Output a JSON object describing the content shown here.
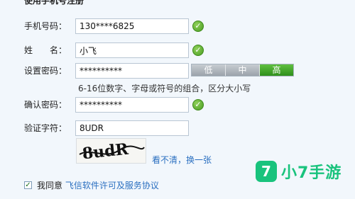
{
  "form": {
    "section_title": "使用手机号注册",
    "phone": {
      "label": "手机号码：",
      "value": "130****6825",
      "valid": true
    },
    "name": {
      "label": "姓　　名：",
      "value": "小飞",
      "valid": true
    },
    "password": {
      "label": "设置密码：",
      "value": "**********",
      "strength": {
        "options": [
          "低",
          "中",
          "高"
        ],
        "selected": "高"
      },
      "hint": "6-16位数字、字母或符号的组合，区分大小写"
    },
    "confirm": {
      "label": "确认密码：",
      "value": "**********",
      "valid": true
    },
    "captcha": {
      "label": "验证字符：",
      "value": "8UDR",
      "image_text": "8udR",
      "refresh_link": "看不清，换一张"
    },
    "agreement": {
      "checked": true,
      "prefix": "我同意",
      "link": "飞信软件许可及服务协议"
    }
  },
  "watermark": {
    "logo": "7",
    "text": "小7手游"
  },
  "colors": {
    "accent_green": "#3aa022",
    "link": "#2a6fc0",
    "watermark": "#19c37d"
  }
}
